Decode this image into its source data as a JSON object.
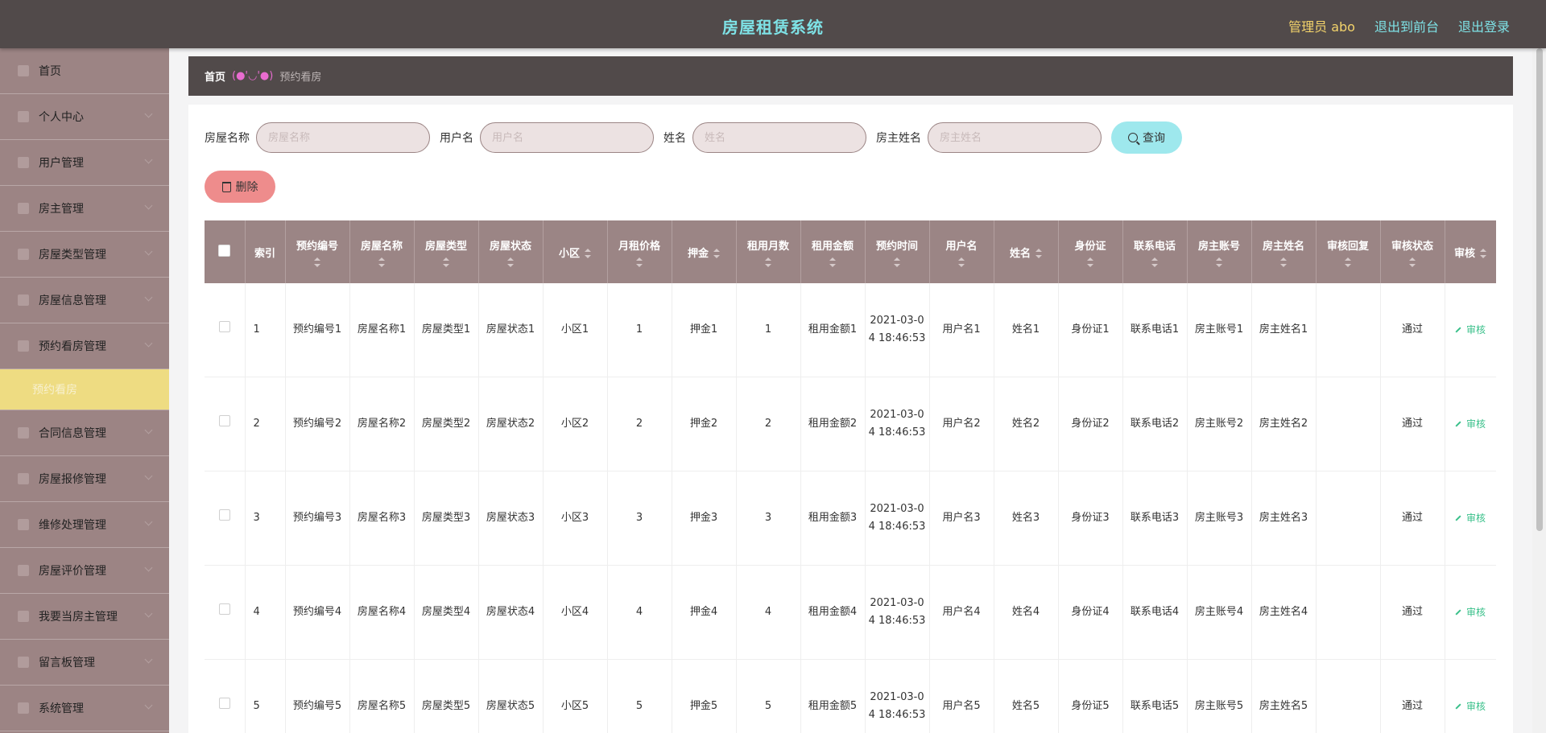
{
  "header": {
    "title": "房屋租赁系统",
    "admin": "管理员 abo",
    "front_link": "退出到前台",
    "logout_link": "退出登录"
  },
  "sidebar": {
    "items": [
      {
        "label": "首页",
        "icon": "home-icon",
        "caret": false
      },
      {
        "label": "个人中心",
        "icon": "user-icon",
        "caret": true
      },
      {
        "label": "用户管理",
        "icon": "users-icon",
        "caret": true
      },
      {
        "label": "房主管理",
        "icon": "landlord-icon",
        "caret": true
      },
      {
        "label": "房屋类型管理",
        "icon": "grid-icon",
        "caret": true
      },
      {
        "label": "房屋信息管理",
        "icon": "house-info-icon",
        "caret": true
      },
      {
        "label": "预约看房管理",
        "icon": "list-icon",
        "caret": true
      }
    ],
    "active_sub": "预约看房",
    "items_after": [
      {
        "label": "合同信息管理",
        "icon": "contract-icon",
        "caret": true
      },
      {
        "label": "房屋报修管理",
        "icon": "repair-icon",
        "caret": true
      },
      {
        "label": "维修处理管理",
        "icon": "tool-icon",
        "caret": true
      },
      {
        "label": "房屋评价管理",
        "icon": "review-icon",
        "caret": true
      },
      {
        "label": "我要当房主管理",
        "icon": "apply-icon",
        "caret": true
      },
      {
        "label": "留言板管理",
        "icon": "message-icon",
        "caret": true
      },
      {
        "label": "系统管理",
        "icon": "settings-icon",
        "caret": true
      }
    ]
  },
  "breadcrumb": {
    "home": "首页",
    "separator": "(●'◡'●)",
    "current": "预约看房"
  },
  "filters": {
    "house_name_label": "房屋名称",
    "house_name_placeholder": "房屋名称",
    "username_label": "用户名",
    "username_placeholder": "用户名",
    "name_label": "姓名",
    "name_placeholder": "姓名",
    "owner_name_label": "房主姓名",
    "owner_name_placeholder": "房主姓名",
    "search_label": "查询"
  },
  "delete_label": "删除",
  "table": {
    "headers": [
      "索引",
      "预约编号",
      "房屋名称",
      "房屋类型",
      "房屋状态",
      "小区",
      "月租价格",
      "押金",
      "租用月数",
      "租用金额",
      "预约时间",
      "用户名",
      "姓名",
      "身份证",
      "联系电话",
      "房主账号",
      "房主姓名",
      "审核回复",
      "审核状态",
      "审核"
    ],
    "rows": [
      [
        "1",
        "预约编号1",
        "房屋名称1",
        "房屋类型1",
        "房屋状态1",
        "小区1",
        "1",
        "押金1",
        "1",
        "租用金额1",
        "2021-03-04 18:46:53",
        "用户名1",
        "姓名1",
        "身份证1",
        "联系电话1",
        "房主账号1",
        "房主姓名1",
        "",
        "通过",
        "审核"
      ],
      [
        "2",
        "预约编号2",
        "房屋名称2",
        "房屋类型2",
        "房屋状态2",
        "小区2",
        "2",
        "押金2",
        "2",
        "租用金额2",
        "2021-03-04 18:46:53",
        "用户名2",
        "姓名2",
        "身份证2",
        "联系电话2",
        "房主账号2",
        "房主姓名2",
        "",
        "通过",
        "审核"
      ],
      [
        "3",
        "预约编号3",
        "房屋名称3",
        "房屋类型3",
        "房屋状态3",
        "小区3",
        "3",
        "押金3",
        "3",
        "租用金额3",
        "2021-03-04 18:46:53",
        "用户名3",
        "姓名3",
        "身份证3",
        "联系电话3",
        "房主账号3",
        "房主姓名3",
        "",
        "通过",
        "审核"
      ],
      [
        "4",
        "预约编号4",
        "房屋名称4",
        "房屋类型4",
        "房屋状态4",
        "小区4",
        "4",
        "押金4",
        "4",
        "租用金额4",
        "2021-03-04 18:46:53",
        "用户名4",
        "姓名4",
        "身份证4",
        "联系电话4",
        "房主账号4",
        "房主姓名4",
        "",
        "通过",
        "审核"
      ],
      [
        "5",
        "预约编号5",
        "房屋名称5",
        "房屋类型5",
        "房屋状态5",
        "小区5",
        "5",
        "押金5",
        "5",
        "租用金额5",
        "2021-03-04 18:46:53",
        "用户名5",
        "姓名5",
        "身份证5",
        "联系电话5",
        "房主账号5",
        "房主姓名5",
        "",
        "通过",
        "审核"
      ]
    ]
  },
  "colors": {
    "header_bg": "#514a4a",
    "sidebar_bg": "#9c8484",
    "active_bg": "#eedc82",
    "title": "#7ee2e6",
    "accent_yellow": "#f3d36b",
    "audit": "#39c08a"
  }
}
